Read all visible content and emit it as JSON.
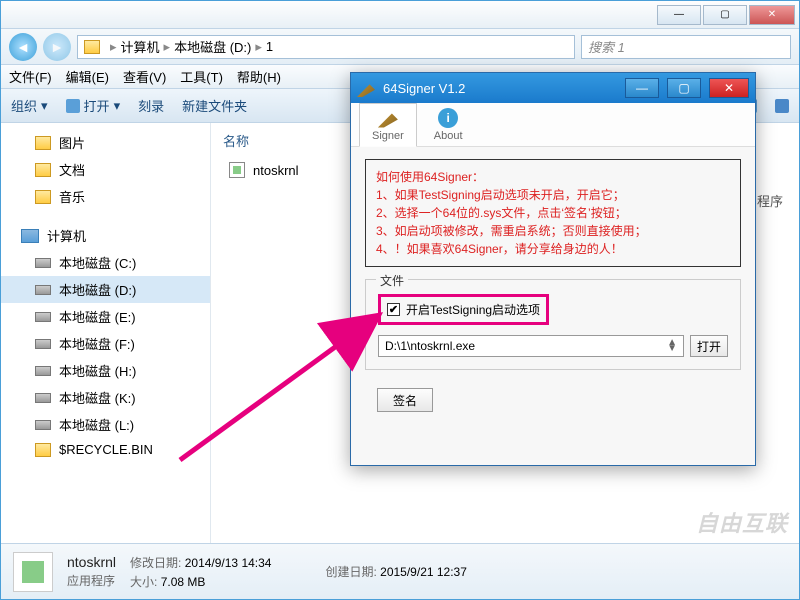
{
  "explorer": {
    "breadcrumb": {
      "root": "计算机",
      "drive": "本地磁盘 (D:)",
      "folder": "1"
    },
    "search_placeholder": "搜索 1",
    "menus": {
      "file": "文件(F)",
      "edit": "编辑(E)",
      "view": "查看(V)",
      "tools": "工具(T)",
      "help": "帮助(H)"
    },
    "toolbar": {
      "org": "组织",
      "open": "打开",
      "burn": "刻录",
      "newfolder": "新建文件夹"
    },
    "sidebar": {
      "pictures": "图片",
      "docs": "文档",
      "music": "音乐",
      "computer": "计算机",
      "drives": [
        "本地磁盘 (C:)",
        "本地磁盘 (D:)",
        "本地磁盘 (E:)",
        "本地磁盘 (F:)",
        "本地磁盘 (H:)",
        "本地磁盘 (K:)",
        "本地磁盘 (L:)"
      ],
      "recycle": "$RECYCLE.BIN"
    },
    "content": {
      "col_name": "名称",
      "file1": "ntoskrnl",
      "right_hint": "用程序"
    },
    "status": {
      "filename": "ntoskrnl",
      "filetype": "应用程序",
      "mod_label": "修改日期:",
      "mod_value": "2014/9/13 14:34",
      "size_label": "大小:",
      "size_value": "7.08 MB",
      "create_label": "创建日期:",
      "create_value": "2015/9/21 12:37"
    }
  },
  "signer": {
    "title": "64Signer V1.2",
    "tabs": {
      "signer": "Signer",
      "about": "About"
    },
    "instructions": {
      "head": "如何使用64Signer：",
      "l1": "1、如果TestSigning启动选项未开启，开启它；",
      "l2": "2、选择一个64位的.sys文件，点击‘签名’按钮；",
      "l3": "3、如启动项被修改，需重启系统；否则直接使用；",
      "l4": "4、！如果喜欢64Signer，请分享给身边的人！"
    },
    "filegroup": {
      "legend": "文件",
      "checkbox_label": "开启TestSigning启动选项",
      "path": "D:\\1\\ntoskrnl.exe",
      "open": "打开"
    },
    "sign_button": "签名"
  },
  "watermark": "自由互联"
}
